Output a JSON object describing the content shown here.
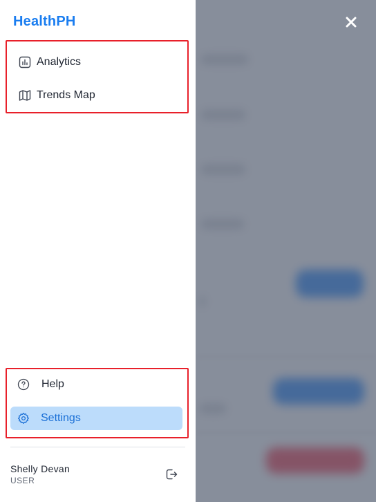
{
  "app": {
    "brand": "HealthPH"
  },
  "nav": {
    "primary": [
      {
        "label": "Analytics",
        "icon": "bar-chart-icon"
      },
      {
        "label": "Trends Map",
        "icon": "map-icon"
      }
    ],
    "secondary": [
      {
        "label": "Help",
        "icon": "help-circle-icon"
      },
      {
        "label": "Settings",
        "icon": "gear-icon",
        "active": true
      }
    ]
  },
  "user": {
    "name": "Shelly Devan",
    "role": "USER"
  },
  "colors": {
    "brand": "#1a7df0",
    "active_bg": "#bcdcfb",
    "highlight_border": "#e8202a"
  }
}
